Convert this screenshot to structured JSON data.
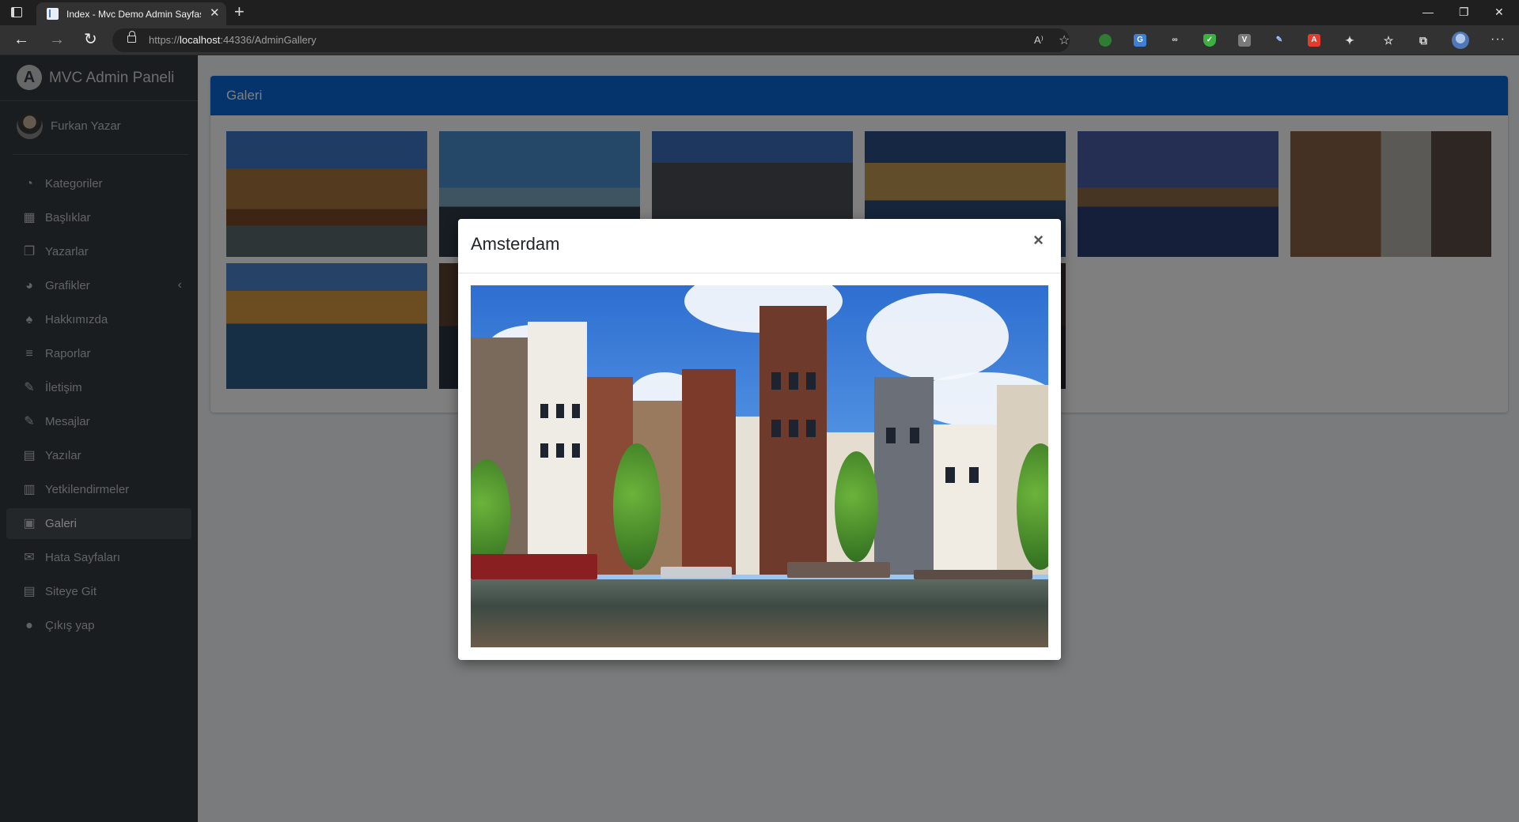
{
  "browser": {
    "tab_title": "Index - Mvc Demo Admin Sayfası",
    "url_prefix": "https://",
    "url_host": "localhost",
    "url_rest": ":44336/AdminGallery",
    "read_aloud": "A⁾",
    "window_controls": [
      "—",
      "❐",
      "✕"
    ]
  },
  "sidebar": {
    "brand": "MVC Admin Paneli",
    "user_name": "Furkan Yazar",
    "items": [
      {
        "label": "Kategoriler",
        "icon": "dashboard-icon"
      },
      {
        "label": "Başlıklar",
        "icon": "grid-icon"
      },
      {
        "label": "Yazarlar",
        "icon": "copy-icon"
      },
      {
        "label": "Grafikler",
        "icon": "pie-chart-icon"
      },
      {
        "label": "Hakkımızda",
        "icon": "tree-icon"
      },
      {
        "label": "Raporlar",
        "icon": "list-icon"
      },
      {
        "label": "İletişim",
        "icon": "edit-icon"
      },
      {
        "label": "Mesajlar",
        "icon": "edit-icon"
      },
      {
        "label": "Yazılar",
        "icon": "table-icon"
      },
      {
        "label": "Yetkilendirmeler",
        "icon": "calendar-icon"
      },
      {
        "label": "Galeri",
        "icon": "image-icon"
      },
      {
        "label": "Hata Sayfaları",
        "icon": "envelope-icon"
      },
      {
        "label": "Siteye Git",
        "icon": "book-icon"
      },
      {
        "label": "Çıkış yap",
        "icon": "apple-icon"
      }
    ],
    "active_item": "Galeri"
  },
  "gallery": {
    "title": "Galeri"
  },
  "modal": {
    "title": "Amsterdam",
    "close_label": "×"
  }
}
